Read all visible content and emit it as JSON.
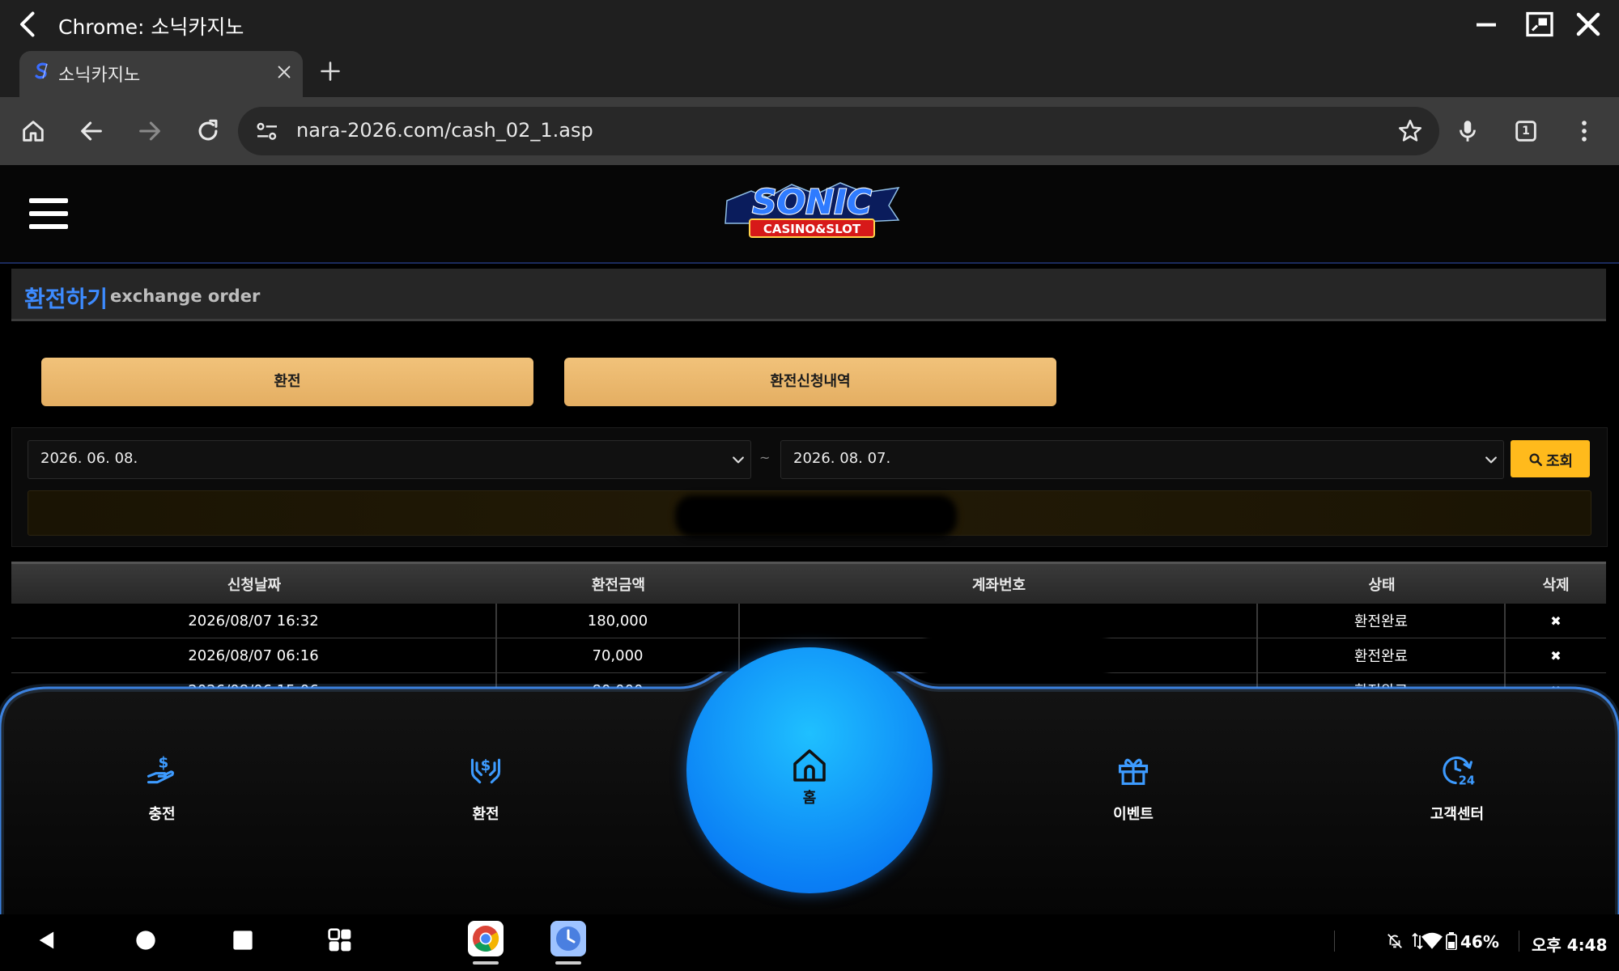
{
  "window": {
    "title": "Chrome: 소닉카지노"
  },
  "tabs": [
    {
      "label": "소닉카지노"
    }
  ],
  "omnibox": {
    "url": "nara-2026.com/cash_02_1.asp"
  },
  "toolbar": {
    "tab_count": "1"
  },
  "logo": {
    "main": "SONIC",
    "sub": "CASINO&SLOT"
  },
  "page": {
    "title_ko": "환전하기",
    "title_en": "exchange order"
  },
  "buttons": {
    "exchange": "환전",
    "history": "환전신청내역"
  },
  "filter": {
    "date_from": "2026. 06. 08.",
    "date_to": "2026. 08. 07.",
    "separator": "~",
    "search_label": "조회"
  },
  "table": {
    "headers": [
      "신청날짜",
      "환전금액",
      "계좌번호",
      "상태",
      "삭제"
    ],
    "rows": [
      {
        "date": "2026/08/07 16:32",
        "amount": "180,000",
        "account": "",
        "status": "환전완료",
        "delete": "✖"
      },
      {
        "date": "2026/08/07 06:16",
        "amount": "70,000",
        "account": "",
        "status": "환전완료",
        "delete": "✖"
      },
      {
        "date": "2026/08/06 15:06",
        "amount": "80,000",
        "account": "",
        "status": "환전완료",
        "delete": "✖"
      }
    ]
  },
  "bottom_nav": {
    "charge": "충전",
    "exchange": "환전",
    "home": "홈",
    "event": "이벤트",
    "support": "고객센터"
  },
  "status_bar": {
    "battery": "46%",
    "time": "오후 4:48"
  },
  "colors": {
    "accent_blue": "#3d8bff",
    "gold_button": "#e9b76c",
    "search_button": "#ffba1c",
    "home_circle": "#0a7ef5"
  }
}
